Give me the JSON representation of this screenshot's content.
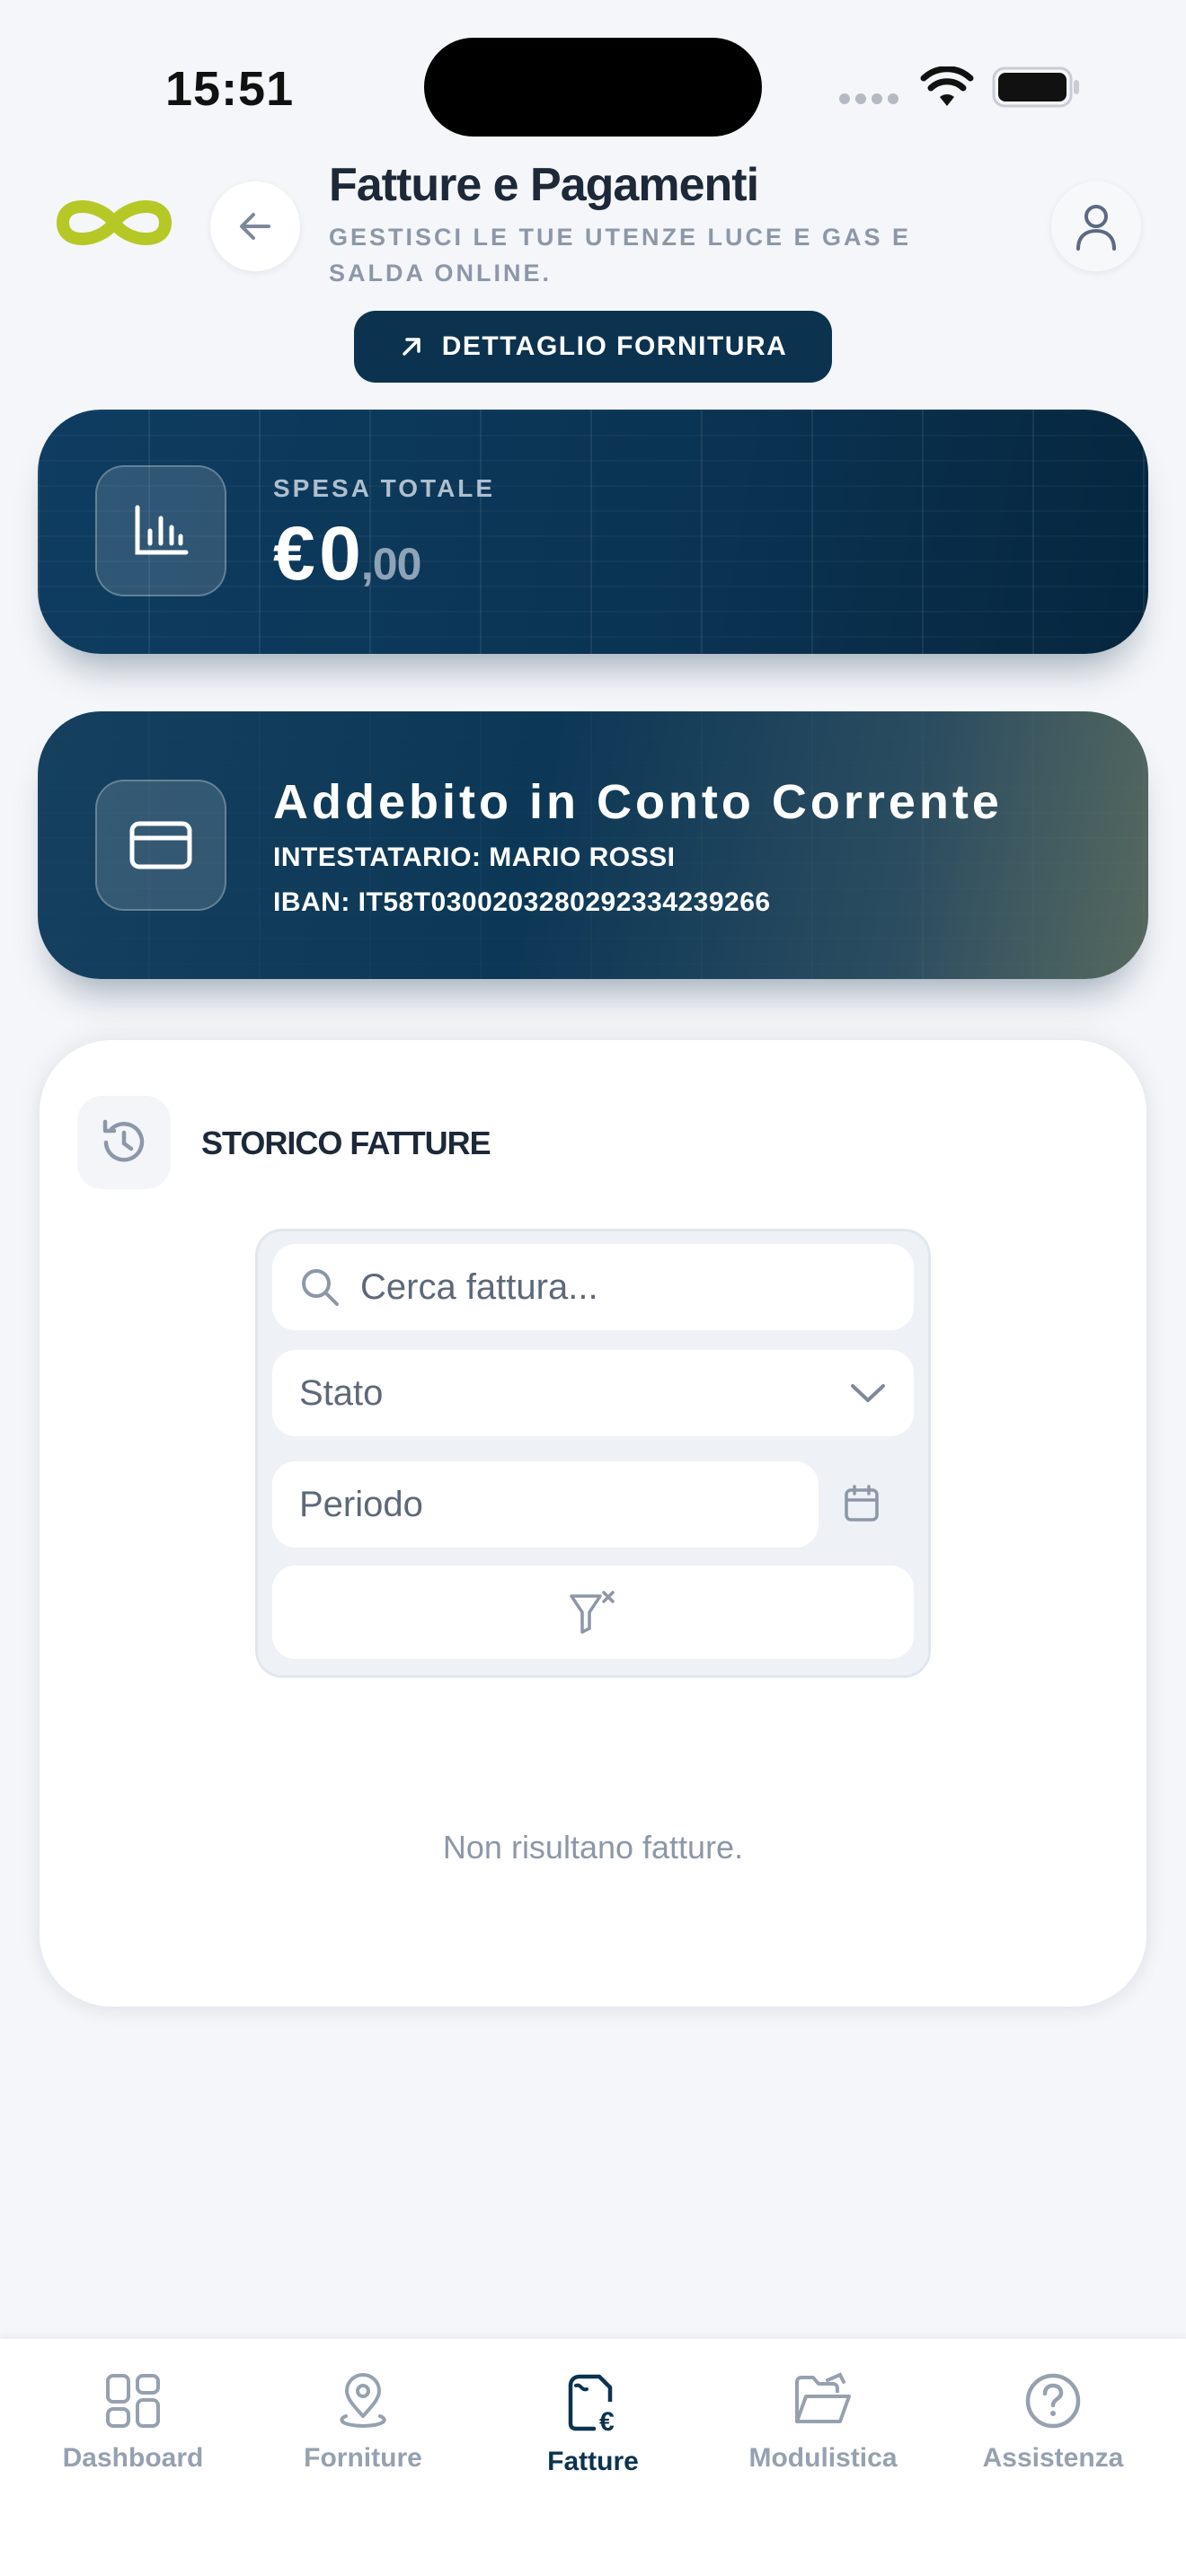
{
  "status_bar": {
    "time": "15:51"
  },
  "header": {
    "title": "Fatture e Pagamenti",
    "subtitle": "GESTISCI LE TUE UTENZE LUCE E GAS E SALDA ONLINE.",
    "detail_button": "DETTAGLIO FORNITURA"
  },
  "total_card": {
    "label": "SPESA TOTALE",
    "currency": "€",
    "amount": "0",
    "decimals": ",00"
  },
  "payment_card": {
    "title": "Addebito in Conto Corrente",
    "holder": "INTESTATARIO: MARIO ROSSI",
    "iban": "IBAN: IT58T0300203280292334239266"
  },
  "invoices": {
    "title": "STORICO FATTURE",
    "search_placeholder": "Cerca fattura...",
    "state_select": "Stato",
    "period_placeholder": "Periodo",
    "empty_text": "Non risultano fatture."
  },
  "bottom_nav": {
    "items": [
      {
        "label": "Dashboard",
        "icon": "grid-icon",
        "active": false
      },
      {
        "label": "Forniture",
        "icon": "map-pin-icon",
        "active": false
      },
      {
        "label": "Fatture",
        "icon": "invoice-euro-icon",
        "active": true
      },
      {
        "label": "Modulistica",
        "icon": "folder-open-icon",
        "active": false
      },
      {
        "label": "Assistenza",
        "icon": "help-circle-icon",
        "active": false
      }
    ]
  },
  "colors": {
    "brand_dark": "#0b3350",
    "logo_green": "#b6c826",
    "muted_text": "#8c97a8"
  }
}
